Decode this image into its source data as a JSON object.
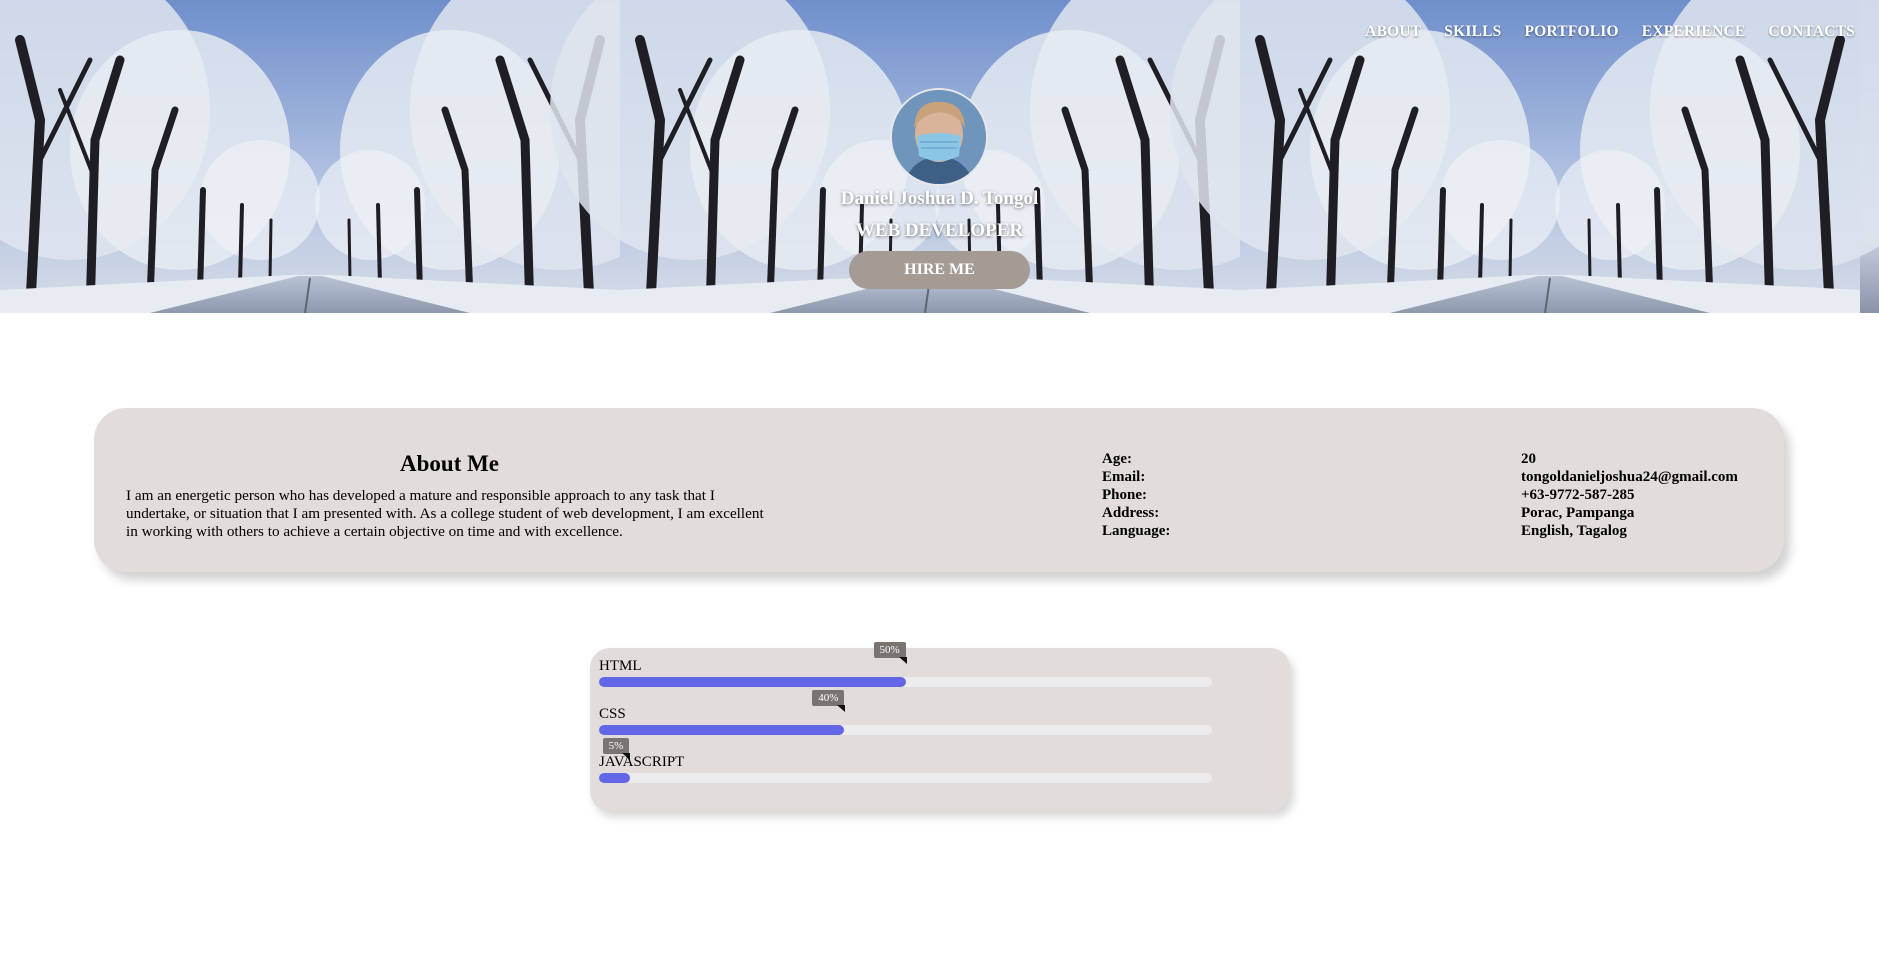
{
  "nav": {
    "items": [
      "ABOUT",
      "SKILLS",
      "PORTFOLIO",
      "EXPERIENCE",
      "CONTACTS"
    ]
  },
  "hero": {
    "name": "Daniel Joshua D. Tongol",
    "role": "WEB DEVELOPER",
    "hire_label": "HIRE ME"
  },
  "about": {
    "title": "About Me",
    "description": "I am an energetic person who has developed a mature and responsible approach to any task that I undertake, or situation that I am presented with. As a college student of web development, I am excellent in working with others to achieve a certain objective on time and with excellence.",
    "fields": [
      {
        "label": "Age:",
        "value": "20"
      },
      {
        "label": "Email:",
        "value": "tongoldanieljoshua24@gmail.com"
      },
      {
        "label": "Phone:",
        "value": "+63-9772-587-285"
      },
      {
        "label": "Address:",
        "value": "Porac, Pampanga"
      },
      {
        "label": "Language:",
        "value": "English, Tagalog"
      }
    ]
  },
  "skills": [
    {
      "name": "HTML",
      "percent": 50,
      "label": "50%"
    },
    {
      "name": "CSS",
      "percent": 40,
      "label": "40%"
    },
    {
      "name": "JAVASCRIPT",
      "percent": 5,
      "label": "5%"
    }
  ],
  "colors": {
    "bar_fill": "#6466e8",
    "bar_track": "#ecebee",
    "card_bg": "#e2dcda",
    "hire_button": "#a49b95"
  }
}
